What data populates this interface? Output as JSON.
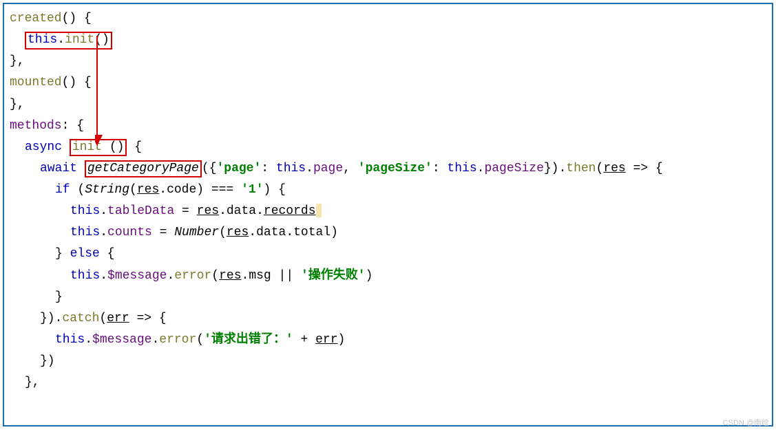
{
  "code": {
    "l1": {
      "created": "created",
      "open": "() {"
    },
    "l2": {
      "this": "this",
      "dot": ".",
      "init": "init",
      "call": "()"
    },
    "l3": {
      "close": "},"
    },
    "l4": {
      "mounted": "mounted",
      "open": "() {"
    },
    "l5": {
      "close": "},"
    },
    "l6": {
      "methods": "methods",
      "open": ": {"
    },
    "l7": {
      "async": "async ",
      "init": "init ",
      "paren": "()",
      "brace": " {"
    },
    "l8": {
      "await": "await ",
      "getCategoryPage": "getCategoryPage",
      "open": "({",
      "q1": "'",
      "page": "page",
      "q2": "'",
      "colon1": ": ",
      "this1": "this",
      "dot1": ".",
      "pageProp": "page",
      "comma": ", ",
      "q3": "'",
      "pageSize": "pageSize",
      "q4": "'",
      "colon2": ": ",
      "this2": "this",
      "dot2": ".",
      "pageSizeProp": "pageSize",
      "close": "}).",
      "then": "then",
      "open2": "(",
      "res": "res",
      "arrow": " => {"
    },
    "l9": {
      "if": "if",
      "open": " (",
      "String": "String",
      "open2": "(",
      "res": "res",
      "dot": ".",
      "code": "code",
      "close": ") === ",
      "q1": "'",
      "one": "1",
      "q2": "'",
      "close2": ") {"
    },
    "l10": {
      "this": "this",
      "dot": ".",
      "tableData": "tableData",
      "eq": " = ",
      "res": "res",
      "dot2": ".",
      "data": "data",
      "dot3": ".",
      "records": "records"
    },
    "l11": {
      "this": "this",
      "dot": ".",
      "counts": "counts",
      "eq": " = ",
      "Number": "Number",
      "open": "(",
      "res": "res",
      "dot2": ".",
      "data": "data",
      "dot3": ".",
      "total": "total",
      "close": ")"
    },
    "l12": {
      "close": "} ",
      "else": "else",
      "open": " {"
    },
    "l13": {
      "this": "this",
      "dot": ".",
      "msg": "$message",
      "dot2": ".",
      "error": "error",
      "open": "(",
      "res": "res",
      "dot3": ".",
      "msgp": "msg",
      "or": " || ",
      "q1": "'",
      "text": "操作失败",
      "q2": "'",
      "close": ")"
    },
    "l14": {
      "close": "}"
    },
    "l15": {
      "close": "}).",
      "catch": "catch",
      "open": "(",
      "err": "err",
      "arrow": " => {"
    },
    "l16": {
      "this": "this",
      "dot": ".",
      "msg": "$message",
      "dot2": ".",
      "error": "error",
      "open": "(",
      "q1": "'",
      "text": "请求出错了：",
      "q2": "'",
      "plus": " + ",
      "err": "err",
      "close": ")"
    },
    "l17": {
      "close": "})"
    },
    "l18": {
      "close": "},"
    }
  },
  "watermark": "CSDN @南绘"
}
